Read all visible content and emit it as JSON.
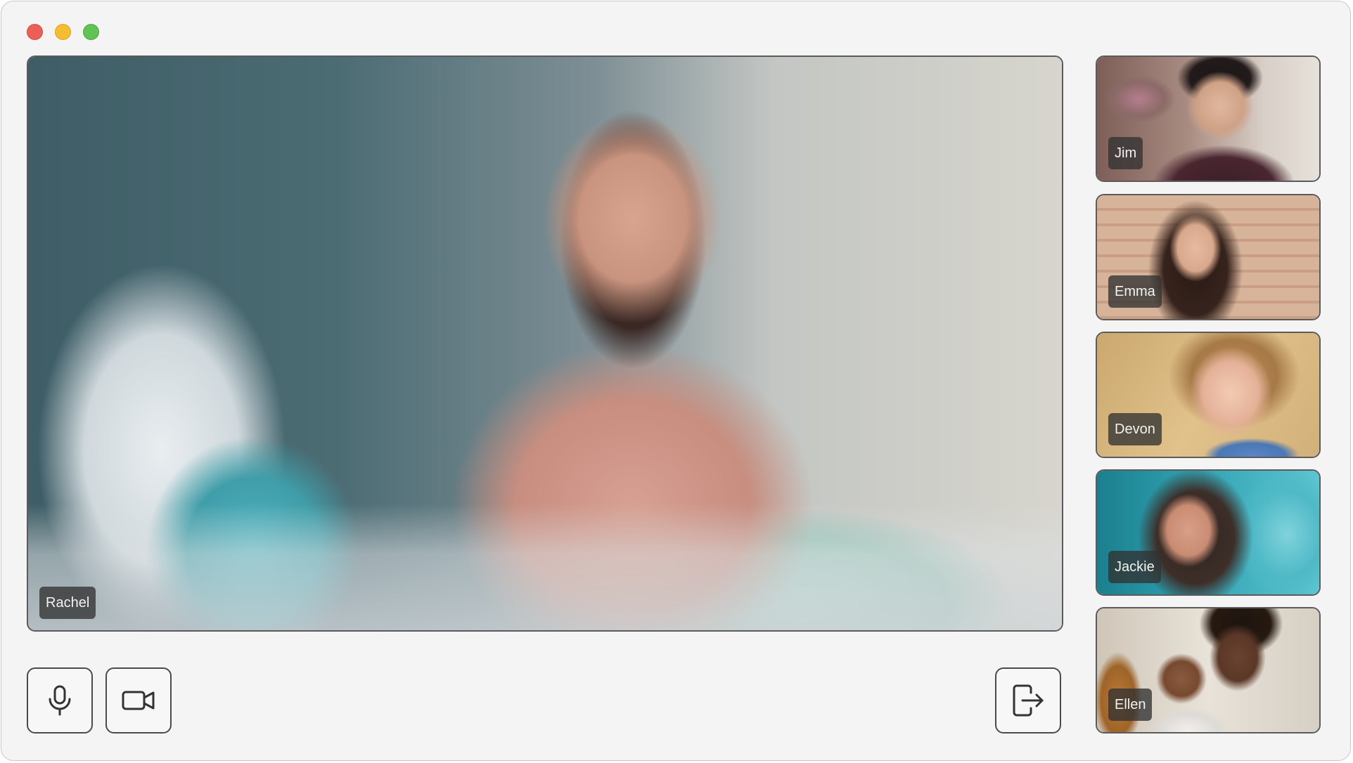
{
  "window": {
    "controls": [
      "close",
      "minimize",
      "maximize"
    ]
  },
  "main_video": {
    "participant_name": "Rachel"
  },
  "participants": [
    {
      "name": "Jim"
    },
    {
      "name": "Emma"
    },
    {
      "name": "Devon"
    },
    {
      "name": "Jackie"
    },
    {
      "name": "Ellen"
    }
  ],
  "controls": {
    "microphone_icon": "microphone-icon",
    "camera_icon": "video-camera-icon",
    "leave_icon": "leave-call-icon"
  },
  "colors": {
    "window_background": "#f4f4f4",
    "tile_border": "#5b5b5b",
    "name_tag_background": "#323232",
    "traffic_close": "#ec5f57",
    "traffic_minimize": "#f5bd2f",
    "traffic_maximize": "#5fc454"
  }
}
